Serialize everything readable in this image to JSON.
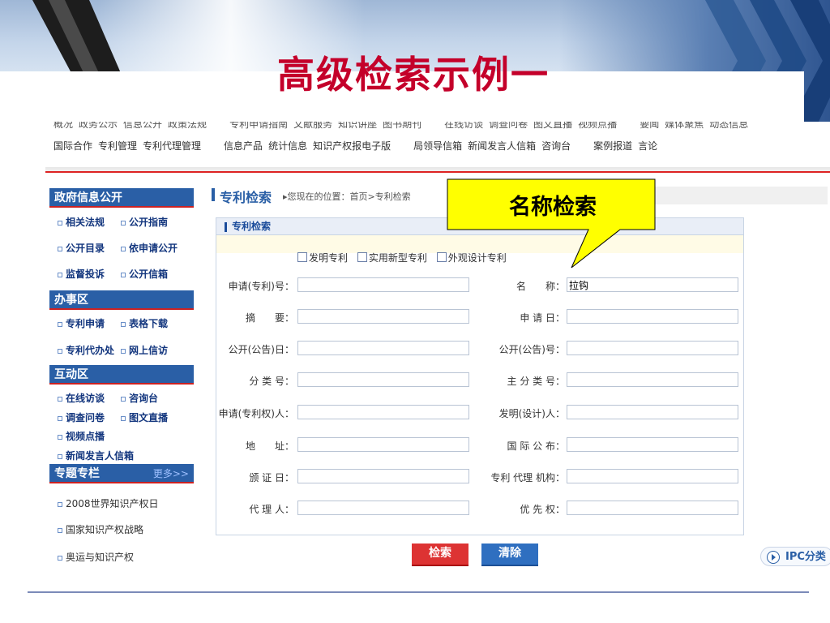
{
  "slide": {
    "title": "高级检索示例一"
  },
  "callout": {
    "text": "名称检索"
  },
  "topnav": {
    "row1": [
      "概况",
      "政务公示",
      "信息公开",
      "政策法规",
      "专利申请指南",
      "文献服务",
      "知识讲座",
      "图书期刊",
      "在线访谈",
      "调查问卷",
      "图文直播",
      "视频点播",
      "要闻",
      "媒体聚焦",
      "动态信息"
    ],
    "row2": [
      "国际合作",
      "专利管理",
      "专利代理管理",
      "信息产品",
      "统计信息",
      "知识产权报电子版",
      "局领导信箱",
      "新闻发言人信箱",
      "咨询台",
      "案例报道",
      "言论"
    ]
  },
  "sidebar": {
    "gov_head": "政府信息公开",
    "gov_links": [
      "相关法规",
      "公开指南",
      "公开目录",
      "依申请公开",
      "监督投诉",
      "公开信箱"
    ],
    "work_head": "办事区",
    "work_links": [
      "专利申请",
      "表格下载",
      "专利代办处",
      "网上信访"
    ],
    "interact_head": "互动区",
    "interact_links": [
      "在线访谈",
      "咨询台",
      "调查问卷",
      "图文直播",
      "视频点播",
      "新闻发言人信箱"
    ],
    "topic_head": "专题专栏",
    "topic_more": "更多>>",
    "topic_links": [
      "2008世界知识产权日",
      "国家知识产权战略",
      "奥运与知识产权"
    ]
  },
  "content": {
    "title": "专利检索",
    "breadcrumb": "您现在的位置：首页>专利检索"
  },
  "panel": {
    "head": "专利检索",
    "types": [
      "发明专利",
      "实用新型专利",
      "外观设计专利"
    ],
    "fields_left": [
      {
        "label": "申请(专利)号：",
        "value": ""
      },
      {
        "label": "摘　　要：",
        "value": ""
      },
      {
        "label": "公开(公告)日：",
        "value": ""
      },
      {
        "label": "分 类 号：",
        "value": ""
      },
      {
        "label": "申请(专利权)人：",
        "value": ""
      },
      {
        "label": "地　　址：",
        "value": ""
      },
      {
        "label": "颁 证 日：",
        "value": ""
      },
      {
        "label": "代 理 人：",
        "value": ""
      }
    ],
    "fields_right": [
      {
        "label": "名　　称：",
        "value": "拉钩"
      },
      {
        "label": "申 请 日：",
        "value": ""
      },
      {
        "label": "公开(公告)号：",
        "value": ""
      },
      {
        "label": "主 分 类 号：",
        "value": ""
      },
      {
        "label": "发明(设计)人：",
        "value": ""
      },
      {
        "label": "国 际 公 布：",
        "value": ""
      },
      {
        "label": "专利 代理 机构：",
        "value": ""
      },
      {
        "label": "优 先 权：",
        "value": ""
      }
    ]
  },
  "buttons": {
    "search": "检索",
    "clear": "清除",
    "ipc": "IPC分类"
  }
}
